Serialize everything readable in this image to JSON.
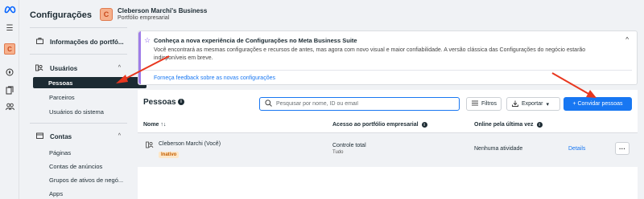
{
  "rail": {
    "logo_icon": "meta-logo-icon",
    "menu_icon": "hamburger-icon",
    "avatar_letter": "C"
  },
  "sidebar": {
    "title": "Configurações",
    "sections": [
      {
        "label": "Informações do portfó...",
        "icon": "briefcase-icon"
      },
      {
        "label": "Usuários",
        "icon": "users-icon",
        "items": [
          "Pessoas",
          "Parceiros",
          "Usuários do sistema"
        ],
        "active": "Pessoas"
      },
      {
        "label": "Contas",
        "icon": "folder-icon",
        "items": [
          "Páginas",
          "Contas de anúncios",
          "Grupos de ativos de negó...",
          "Apps"
        ]
      }
    ]
  },
  "business": {
    "avatar_letter": "C",
    "name": "Cleberson Marchi's Business",
    "subtitle": "Portfólio empresarial"
  },
  "notice": {
    "title": "Conheça a nova experiência de Configurações no Meta Business Suite",
    "body": "Você encontrará as mesmas configurações e recursos de antes, mas agora com novo visual e maior confiabilidade. A versão clássica das Configurações do negócio estarão indisponíveis em breve.",
    "link": "Forneça feedback sobre as novas configurações"
  },
  "people": {
    "title": "Pessoas",
    "search_placeholder": "Pesquisar por nome, ID ou email",
    "filters_label": "Filtros",
    "export_label": "Exportar",
    "invite_label": "+ Convidar pessoas",
    "columns": [
      "Nome ↑↓",
      "Acesso ao portfólio empresarial",
      "Online pela última vez"
    ],
    "rows": [
      {
        "name": "Cleberson Marchi (Você)",
        "status": "Inativo",
        "access": "Controle total",
        "access_detail": "Tudo",
        "last_online": "Nenhuma atividade",
        "details": "Details",
        "more": "···"
      }
    ]
  },
  "colors": {
    "accent": "#1877f2",
    "annotation_arrow": "#e8371f",
    "notice_star": "#7b4ee6"
  }
}
